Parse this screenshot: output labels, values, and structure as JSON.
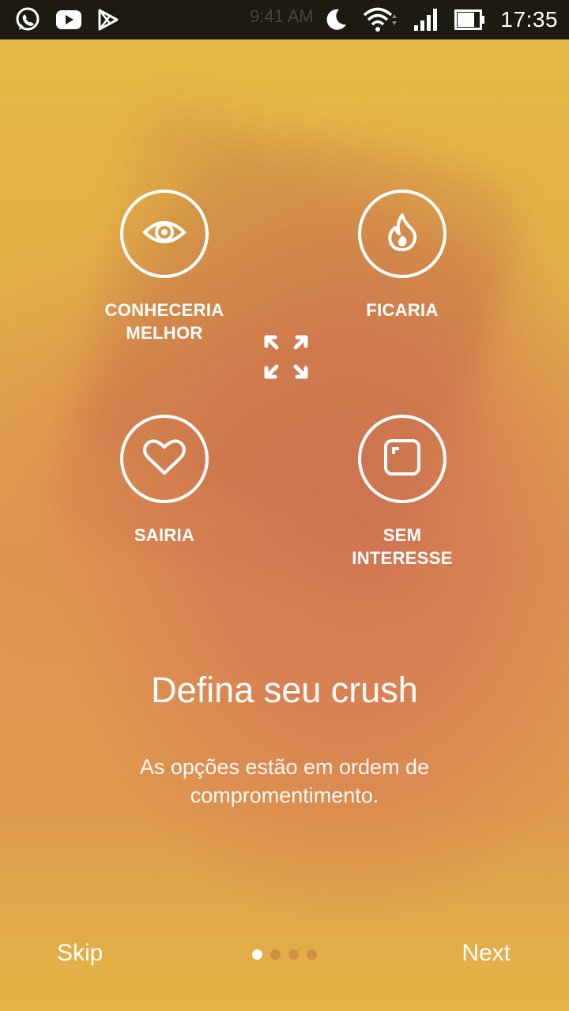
{
  "status_bar": {
    "time": "17:35",
    "ghost_time": "9:41 AM",
    "left_icons": [
      "whatsapp-icon",
      "youtube-icon",
      "play-store-icon"
    ],
    "right_icons": [
      "moon-icon",
      "wifi-icon",
      "signal-icon",
      "battery-icon"
    ]
  },
  "options": [
    {
      "label": "CONHECERIA\nMELHOR",
      "icon": "eye-icon"
    },
    {
      "label": "FICARIA",
      "icon": "flame-icon"
    },
    {
      "label": "SAIRIA",
      "icon": "heart-icon"
    },
    {
      "label": "SEM\nINTERESSE",
      "icon": "square-icon"
    }
  ],
  "center_icon": "expand-icon",
  "headline": "Defina seu crush",
  "subtext": "As opções estão em ordem de compromentimento.",
  "footer": {
    "skip_label": "Skip",
    "next_label": "Next",
    "page_count": 4,
    "active_page": 1
  },
  "colors": {
    "background_top": "#e4ba45",
    "background_center": "#d67a54",
    "foreground": "#ffffff",
    "status_bar": "#1d1a12"
  }
}
